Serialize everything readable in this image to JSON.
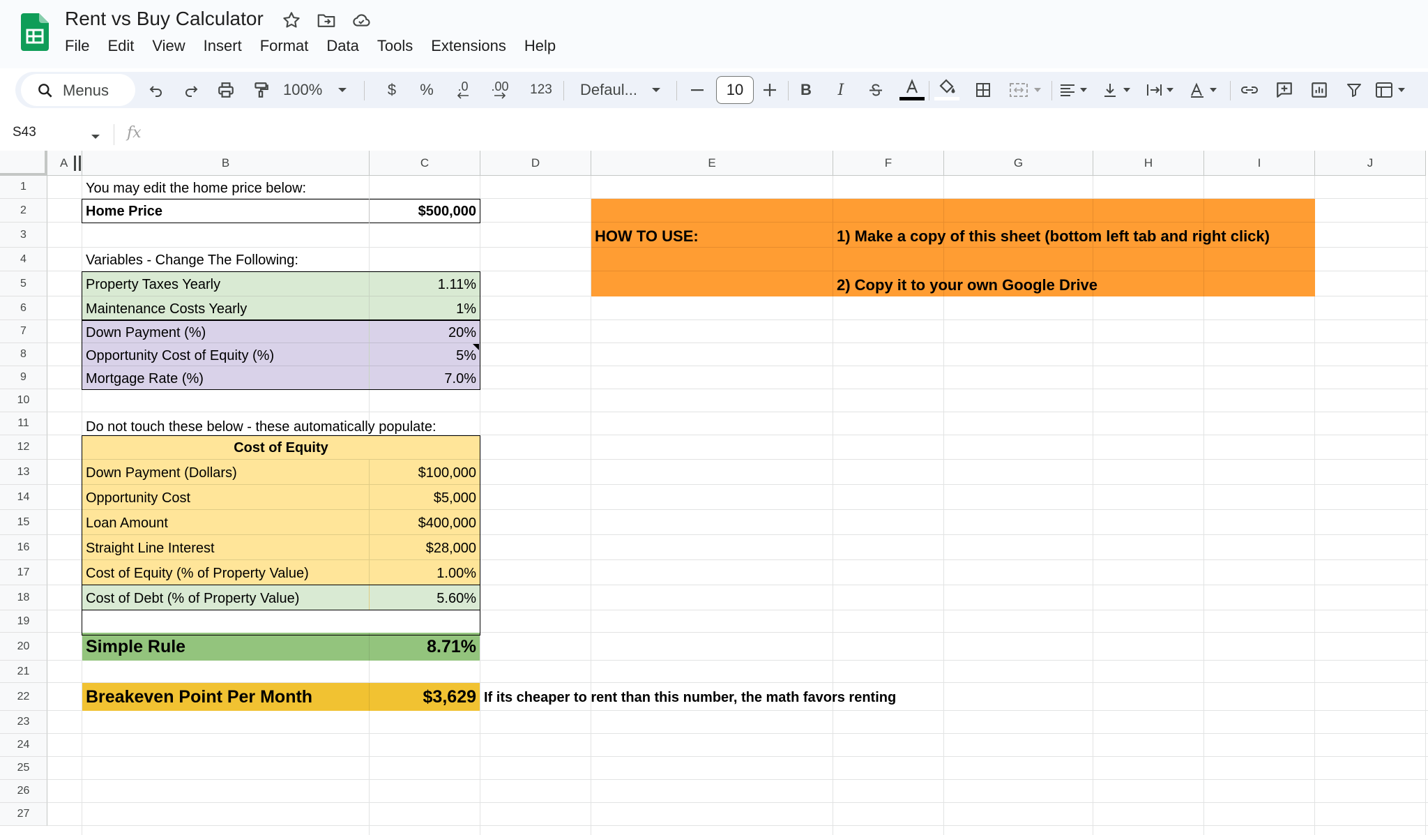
{
  "app": {
    "title": "Rent vs Buy Calculator",
    "menu": [
      "File",
      "Edit",
      "View",
      "Insert",
      "Format",
      "Data",
      "Tools",
      "Extensions",
      "Help"
    ]
  },
  "toolbar": {
    "search_label": "Menus",
    "zoom": "100%",
    "currency": "$",
    "percent": "%",
    "decrease_decimal": ".0",
    "increase_decimal": ".00",
    "number_format": "123",
    "font": "Defaul...",
    "font_size": "10",
    "bold": "B",
    "italic": "I"
  },
  "formula_bar": {
    "cell_ref": "S43",
    "fx": "fx"
  },
  "columns": [
    "A",
    "B",
    "C",
    "D",
    "E",
    "F",
    "G",
    "H",
    "I",
    "J"
  ],
  "rows": [
    "1",
    "2",
    "3",
    "4",
    "5",
    "6",
    "7",
    "8",
    "9",
    "10",
    "11",
    "12",
    "13",
    "14",
    "15",
    "16",
    "17",
    "18",
    "19",
    "20",
    "21",
    "22",
    "23",
    "24",
    "25",
    "26",
    "27"
  ],
  "sheet": {
    "r1_note": "You may edit the home price below:",
    "home_price_label": "Home Price",
    "home_price_value": "$500,000",
    "variables_heading": "Variables - Change The Following:",
    "variables": [
      {
        "label": "Property Taxes Yearly",
        "value": "1.11%"
      },
      {
        "label": "Maintenance Costs Yearly",
        "value": "1%"
      },
      {
        "label": "Down Payment (%)",
        "value": "20%"
      },
      {
        "label": "Opportunity Cost of Equity (%)",
        "value": "5%"
      },
      {
        "label": "Mortgage Rate (%)",
        "value": "7.0%"
      }
    ],
    "auto_heading": "Do not touch these below - these automatically populate:",
    "cost_of_equity_title": "Cost of Equity",
    "computed": [
      {
        "label": "Down Payment (Dollars)",
        "value": "$100,000"
      },
      {
        "label": "Opportunity Cost",
        "value": "$5,000"
      },
      {
        "label": "Loan Amount",
        "value": "$400,000"
      },
      {
        "label": "Straight Line Interest",
        "value": "$28,000"
      },
      {
        "label": "Cost of Equity (% of Property Value)",
        "value": "1.00%"
      },
      {
        "label": "Cost of Debt (% of Property Value)",
        "value": "5.60%"
      }
    ],
    "simple_rule_label": "Simple Rule",
    "simple_rule_value": "8.71%",
    "breakeven_label": "Breakeven Point Per Month",
    "breakeven_value": "$3,629",
    "breakeven_note": "If its cheaper to rent than this number, the math favors renting",
    "how_to_use_label": "HOW TO USE:",
    "step1": "1) Make a copy of this sheet (bottom left tab and right click)",
    "step2": "2) Copy it to your own Google Drive"
  },
  "colors": {
    "green_fill": "#d9ead3",
    "purple_fill": "#d9d2e9",
    "yellow_fill": "#ffe599",
    "simple_rule_fill": "#93c47d",
    "breakeven_fill": "#f1c232",
    "how_to_fill": "#ff9d33"
  }
}
